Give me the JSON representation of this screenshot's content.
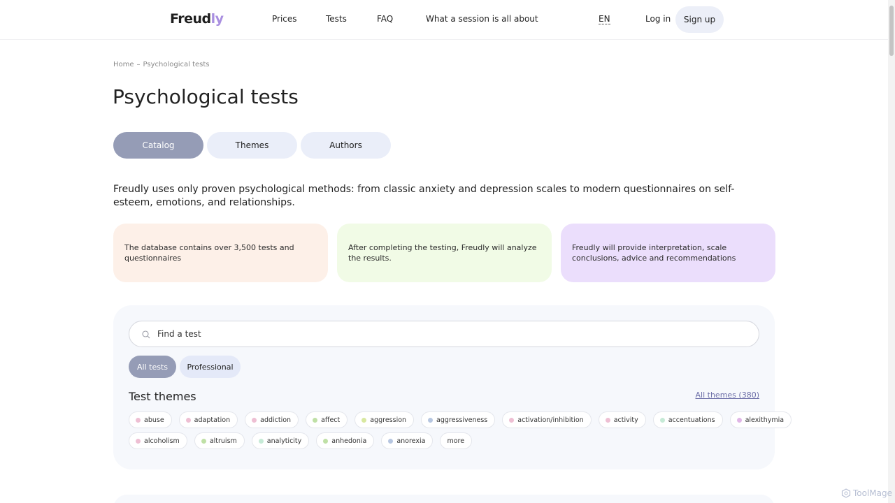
{
  "header": {
    "logo_main": "Freud",
    "logo_accent": "ly",
    "nav": [
      "Prices",
      "Tests",
      "FAQ",
      "What a session is all about"
    ],
    "lang": "EN",
    "login": "Log in",
    "signup": "Sign up"
  },
  "breadcrumb": {
    "home": "Home",
    "separator": "–",
    "current": "Psychological tests"
  },
  "page_title": "Psychological tests",
  "tabs": [
    {
      "label": "Catalog",
      "active": true
    },
    {
      "label": "Themes",
      "active": false
    },
    {
      "label": "Authors",
      "active": false
    }
  ],
  "intro": "Freudly uses only proven psychological methods: from classic anxiety and depression scales to modern questionnaires on self-esteem, emotions, and relationships.",
  "info_cards": [
    {
      "text": "The database contains over 3,500 tests and questionnaires",
      "color": "#fdf0e8"
    },
    {
      "text": "After completing the testing, Freudly will analyze the results.",
      "color": "#f1fbe6"
    },
    {
      "text": "Freudly will provide interpretation, scale conclusions, advice and recommendations",
      "color": "#ebdefc"
    }
  ],
  "search": {
    "placeholder": "Find a test",
    "icon": "search-icon"
  },
  "filters": [
    {
      "label": "All tests",
      "active": true
    },
    {
      "label": "Professional",
      "active": false
    }
  ],
  "themes": {
    "title": "Test themes",
    "all_link": "All themes (380)",
    "row1": [
      {
        "label": "abuse",
        "color": "#eebfd3"
      },
      {
        "label": "adaptation",
        "color": "#eebfd3"
      },
      {
        "label": "addiction",
        "color": "#eebfd3"
      },
      {
        "label": "affect",
        "color": "#bfe0a6"
      },
      {
        "label": "aggression",
        "color": "#d8e8a0"
      },
      {
        "label": "aggressiveness",
        "color": "#b6c6e0"
      },
      {
        "label": "activation/inhibition",
        "color": "#eebfd3"
      },
      {
        "label": "activity",
        "color": "#eebfd3"
      },
      {
        "label": "accentuations",
        "color": "#c6ead6"
      },
      {
        "label": "alexithymia",
        "color": "#e0b6e6"
      }
    ],
    "row2": [
      {
        "label": "alcoholism",
        "color": "#eebfd3"
      },
      {
        "label": "altruism",
        "color": "#bfe0a6"
      },
      {
        "label": "analyticity",
        "color": "#c6ead6"
      },
      {
        "label": "anhedonia",
        "color": "#bfe0a6"
      },
      {
        "label": "anorexia",
        "color": "#b6c6e0"
      }
    ],
    "more": "more"
  },
  "watermark": "ToolMage"
}
